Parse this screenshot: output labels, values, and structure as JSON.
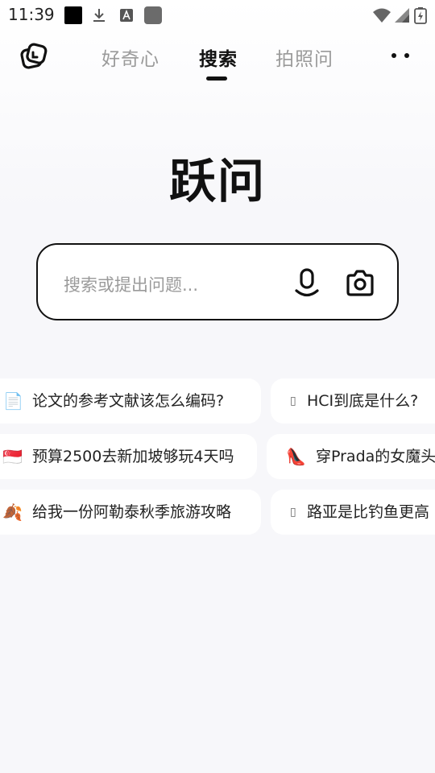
{
  "status_bar": {
    "time": "11:39",
    "icons": [
      "black-square-icon",
      "download-icon",
      "font-a-icon",
      "app-square-icon",
      "wifi-icon",
      "signal-icon",
      "battery-icon"
    ]
  },
  "header": {
    "tabs": [
      {
        "label": "好奇心",
        "active": false
      },
      {
        "label": "搜索",
        "active": true
      },
      {
        "label": "拍照问",
        "active": false
      }
    ]
  },
  "hero": {
    "title": "跃问"
  },
  "search": {
    "placeholder": "搜索或提出问题..."
  },
  "suggestions": [
    {
      "emoji": "📄",
      "text": "论文的参考文献该怎么编码?"
    },
    {
      "emoji": "▯",
      "text": "HCI到底是什么?"
    },
    {
      "emoji": "🇸🇬",
      "text": "预算2500去新加坡够玩4天吗"
    },
    {
      "emoji": "👠",
      "text": "穿Prada的女魔头"
    },
    {
      "emoji": "🍂",
      "text": "给我一份阿勒泰秋季旅游攻略"
    },
    {
      "emoji": "▯",
      "text": "路亚是比钓鱼更高"
    }
  ],
  "colors": {
    "text": "#111111",
    "muted": "#9a9a9a",
    "background": "#f7f7fa",
    "chip": "#ffffff"
  }
}
